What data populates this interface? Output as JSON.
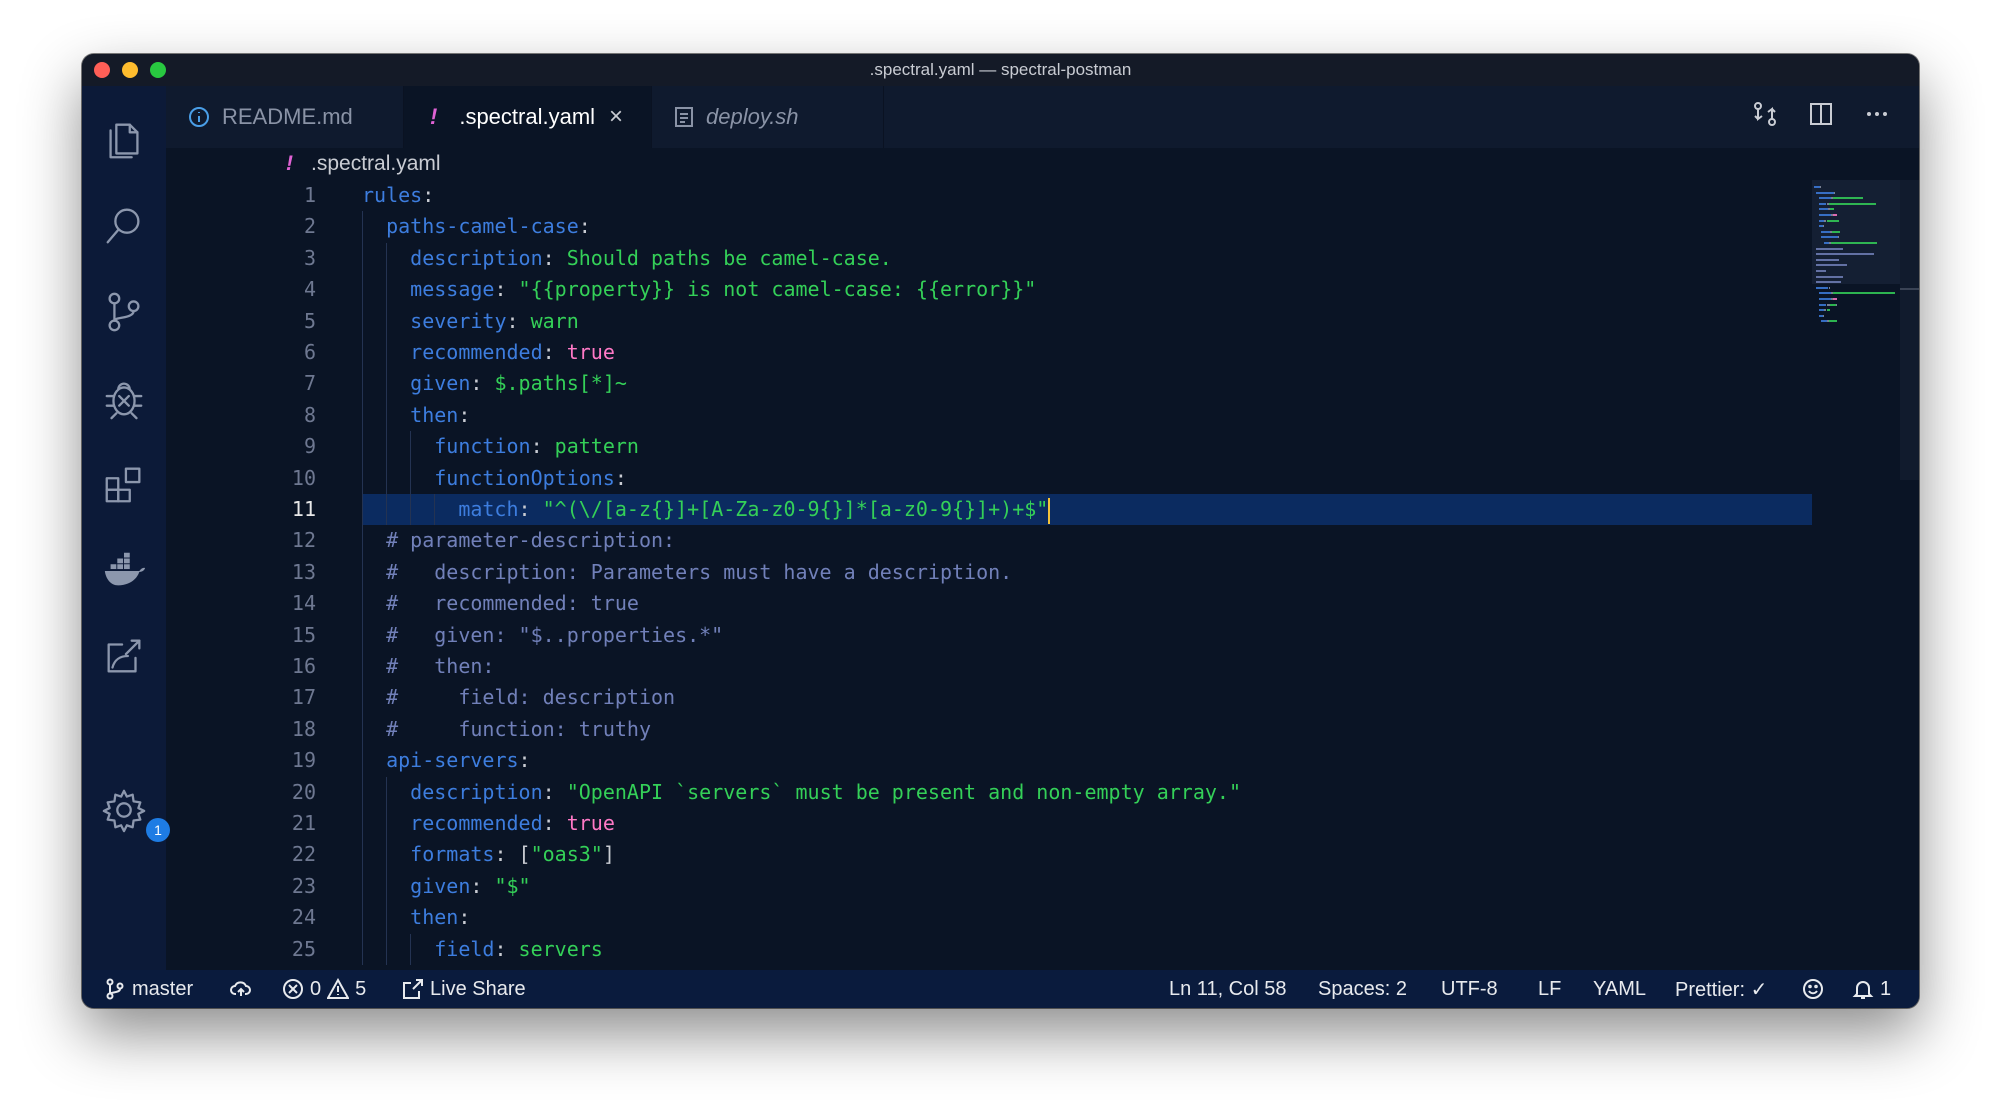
{
  "window": {
    "title": ".spectral.yaml — spectral-postman"
  },
  "activity_bar": {
    "items": [
      "files-icon",
      "search-icon",
      "source-control-icon",
      "debug-icon",
      "extensions-icon",
      "docker-icon",
      "live-share-icon"
    ],
    "settings_badge": "1"
  },
  "tabs": [
    {
      "label": "README.md",
      "icon": "info-icon",
      "active": false
    },
    {
      "label": ".spectral.yaml",
      "icon": "!",
      "active": true,
      "close": "×"
    },
    {
      "label": "deploy.sh",
      "icon": "file-icon",
      "active": false,
      "italic": true
    }
  ],
  "tab_actions": [
    "compare-changes-icon",
    "split-editor-icon",
    "more-actions-icon"
  ],
  "breadcrumb": {
    "icon": "!",
    "file": ".spectral.yaml"
  },
  "editor": {
    "current_line": 11,
    "lines": [
      {
        "n": "1",
        "indent": 0,
        "parts": [
          [
            "k",
            "rules"
          ],
          [
            "p",
            ":"
          ]
        ]
      },
      {
        "n": "2",
        "indent": 1,
        "parts": [
          [
            "k",
            "paths-camel-case"
          ],
          [
            "p",
            ":"
          ]
        ]
      },
      {
        "n": "3",
        "indent": 2,
        "parts": [
          [
            "k",
            "description"
          ],
          [
            "p",
            ": "
          ],
          [
            "s",
            "Should paths be camel-case."
          ]
        ]
      },
      {
        "n": "4",
        "indent": 2,
        "parts": [
          [
            "k",
            "message"
          ],
          [
            "p",
            ": "
          ],
          [
            "s",
            "\"{{property}} is not camel-case: {{error}}\""
          ]
        ]
      },
      {
        "n": "5",
        "indent": 2,
        "parts": [
          [
            "k",
            "severity"
          ],
          [
            "p",
            ": "
          ],
          [
            "s",
            "warn"
          ]
        ]
      },
      {
        "n": "6",
        "indent": 2,
        "parts": [
          [
            "k",
            "recommended"
          ],
          [
            "p",
            ": "
          ],
          [
            "b",
            "true"
          ]
        ]
      },
      {
        "n": "7",
        "indent": 2,
        "parts": [
          [
            "k",
            "given"
          ],
          [
            "p",
            ": "
          ],
          [
            "s",
            "$.paths[*]~"
          ]
        ]
      },
      {
        "n": "8",
        "indent": 2,
        "parts": [
          [
            "k",
            "then"
          ],
          [
            "p",
            ":"
          ]
        ]
      },
      {
        "n": "9",
        "indent": 3,
        "parts": [
          [
            "k",
            "function"
          ],
          [
            "p",
            ": "
          ],
          [
            "s",
            "pattern"
          ]
        ]
      },
      {
        "n": "10",
        "indent": 3,
        "parts": [
          [
            "k",
            "functionOptions"
          ],
          [
            "p",
            ":"
          ]
        ]
      },
      {
        "n": "11",
        "indent": 4,
        "parts": [
          [
            "k",
            "match"
          ],
          [
            "p",
            ": "
          ],
          [
            "s",
            "\"^(\\/[a-z{}]+[A-Za-z0-9{}]*[a-z0-9{}]+)+$\""
          ]
        ],
        "cursor": true
      },
      {
        "n": "12",
        "indent": 1,
        "parts": [
          [
            "c",
            "# parameter-description:"
          ]
        ]
      },
      {
        "n": "13",
        "indent": 1,
        "parts": [
          [
            "c",
            "#   description: Parameters must have a description."
          ]
        ]
      },
      {
        "n": "14",
        "indent": 1,
        "parts": [
          [
            "c",
            "#   recommended: true"
          ]
        ]
      },
      {
        "n": "15",
        "indent": 1,
        "parts": [
          [
            "c",
            "#   given: \"$..properties.*\""
          ]
        ]
      },
      {
        "n": "16",
        "indent": 1,
        "parts": [
          [
            "c",
            "#   then:"
          ]
        ]
      },
      {
        "n": "17",
        "indent": 1,
        "parts": [
          [
            "c",
            "#     field: description"
          ]
        ]
      },
      {
        "n": "18",
        "indent": 1,
        "parts": [
          [
            "c",
            "#     function: truthy"
          ]
        ]
      },
      {
        "n": "19",
        "indent": 1,
        "parts": [
          [
            "k",
            "api-servers"
          ],
          [
            "p",
            ":"
          ]
        ]
      },
      {
        "n": "20",
        "indent": 2,
        "parts": [
          [
            "k",
            "description"
          ],
          [
            "p",
            ": "
          ],
          [
            "s",
            "\"OpenAPI `servers` must be present and non-empty array.\""
          ]
        ]
      },
      {
        "n": "21",
        "indent": 2,
        "parts": [
          [
            "k",
            "recommended"
          ],
          [
            "p",
            ": "
          ],
          [
            "b",
            "true"
          ]
        ]
      },
      {
        "n": "22",
        "indent": 2,
        "parts": [
          [
            "k",
            "formats"
          ],
          [
            "p",
            ": ["
          ],
          [
            "s",
            "\"oas3\""
          ],
          [
            "p",
            "]"
          ]
        ]
      },
      {
        "n": "23",
        "indent": 2,
        "parts": [
          [
            "k",
            "given"
          ],
          [
            "p",
            ": "
          ],
          [
            "s",
            "\"$\""
          ]
        ]
      },
      {
        "n": "24",
        "indent": 2,
        "parts": [
          [
            "k",
            "then"
          ],
          [
            "p",
            ":"
          ]
        ]
      },
      {
        "n": "25",
        "indent": 3,
        "parts": [
          [
            "k",
            "field"
          ],
          [
            "p",
            ": "
          ],
          [
            "s",
            "servers"
          ]
        ]
      }
    ]
  },
  "status_bar": {
    "branch": "master",
    "errors": "0",
    "warnings": "5",
    "live_share": "Live Share",
    "position": "Ln 11, Col 58",
    "spaces": "Spaces: 2",
    "encoding": "UTF-8",
    "eol": "LF",
    "language": "YAML",
    "prettier": "Prettier: ✓",
    "notifications": "1"
  },
  "colors": {
    "key": "#3d7dde",
    "string": "#34d058",
    "boolean": "#ff79c6",
    "comment": "#7180b9",
    "editor_bg": "#0a1425",
    "status_bg": "#0a1b3d"
  }
}
